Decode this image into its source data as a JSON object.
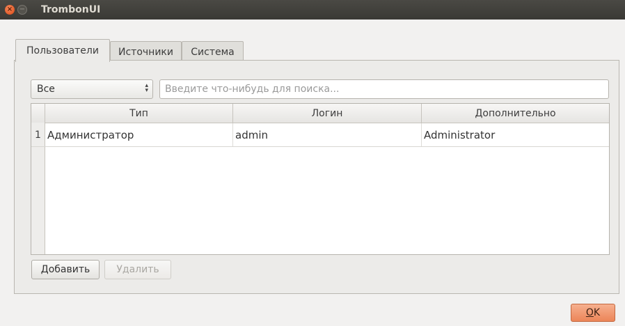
{
  "window": {
    "title": "TrombonUI",
    "close_glyph": "×",
    "minimize_glyph": "−"
  },
  "tabs": [
    {
      "label": "Пользователи",
      "active": true
    },
    {
      "label": "Источники",
      "active": false
    },
    {
      "label": "Система",
      "active": false
    }
  ],
  "filter": {
    "selected": "Все",
    "arrow_up": "▴",
    "arrow_down": "▾"
  },
  "search": {
    "placeholder": "Введите что-нибудь для поиска...",
    "value": ""
  },
  "table": {
    "columns": [
      "Тип",
      "Логин",
      "Дополнительно"
    ],
    "rows": [
      {
        "num": "1",
        "type": "Администратор",
        "login": "admin",
        "extra": "Administrator"
      }
    ]
  },
  "buttons": {
    "add": "Добавить",
    "delete": "Удалить",
    "ok_mnemonic": "O",
    "ok_rest": "K"
  },
  "colors": {
    "titlebar": "#3c3b37",
    "close": "#dd4814",
    "ok": "#ee8e62"
  },
  "icons": {
    "close": "close-icon",
    "minimize": "minimize-icon",
    "combo_arrow": "up-down-arrow-icon"
  }
}
